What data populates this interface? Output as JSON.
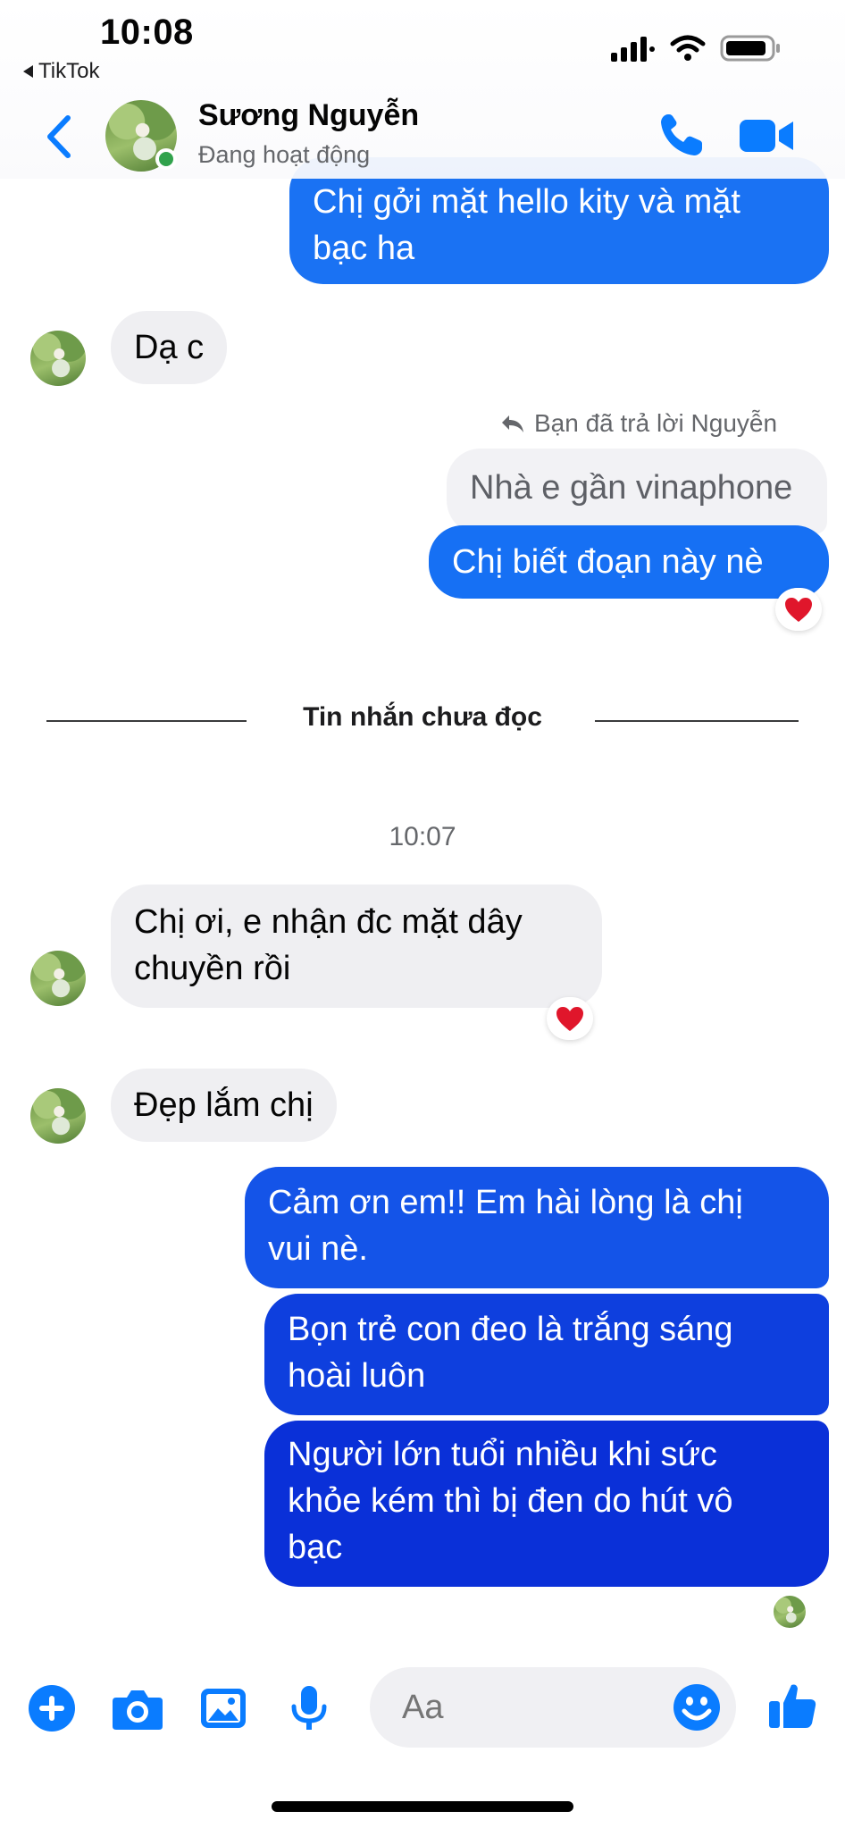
{
  "status_bar": {
    "time": "10:08",
    "back_app": "TikTok"
  },
  "header": {
    "contact_name": "Sương Nguyễn",
    "contact_status": "Đang hoạt động"
  },
  "messages": [
    {
      "side": "out",
      "lines": [
        "Chị gởi mặt hello kity và mặt",
        "bạc ha"
      ]
    },
    {
      "side": "in",
      "text": "Dạ c"
    },
    {
      "reply_label": "Bạn đã trả lời Nguyễn",
      "quoted": "Nhà e gần vinaphone"
    },
    {
      "side": "out",
      "text": "Chị biết đoạn này nè",
      "reaction": "heart"
    },
    {
      "divider": "Tin nhắn chưa đọc"
    },
    {
      "timestamp": "10:07"
    },
    {
      "side": "in",
      "lines": [
        "Chị ơi, e nhận đc mặt dây",
        "chuyền rồi"
      ],
      "reaction": "heart"
    },
    {
      "side": "in",
      "text": "Đẹp lắm chị"
    },
    {
      "side": "out",
      "lines": [
        "Cảm ơn em!! Em hài lòng là chị",
        "vui nè."
      ]
    },
    {
      "side": "out",
      "lines": [
        "Bọn trẻ con đeo là trắng sáng",
        "hoài luôn"
      ]
    },
    {
      "side": "out",
      "lines": [
        "Người lớn tuổi nhiều khi sức",
        "khỏe kém thì bị đen do hút vô",
        "bạc"
      ]
    }
  ],
  "composer": {
    "placeholder": "Aa"
  },
  "icons": {
    "back": "chevron-left-icon",
    "call": "phone-icon",
    "video": "video-camera-icon",
    "add": "plus-circle-icon",
    "camera": "camera-icon",
    "gallery": "image-icon",
    "mic": "microphone-icon",
    "emoji": "smiley-icon",
    "like": "thumbs-up-icon"
  },
  "colors": {
    "accent": "#0a7cff",
    "bubble_out_top": "#1877f2",
    "bubble_out_bottom": "#1f1fd6",
    "bubble_in": "#efeff2",
    "online": "#31a24c"
  }
}
